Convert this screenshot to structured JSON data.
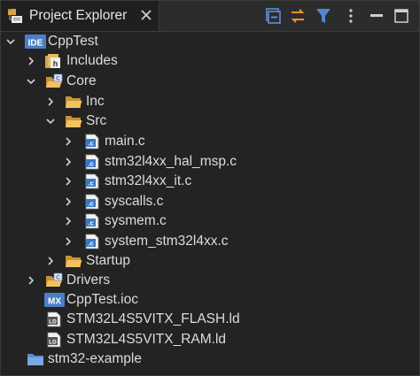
{
  "view": {
    "title": "Project Explorer"
  },
  "tree": {
    "project": "CppTest",
    "includes": "Includes",
    "core": "Core",
    "inc": "Inc",
    "src": "Src",
    "files": [
      "main.c",
      "stm32l4xx_hal_msp.c",
      "stm32l4xx_it.c",
      "syscalls.c",
      "sysmem.c",
      "system_stm32l4xx.c"
    ],
    "startup": "Startup",
    "drivers": "Drivers",
    "ioc": "CppTest.ioc",
    "flash_ld": "STM32L4S5VITX_FLASH.ld",
    "ram_ld": "STM32L4S5VITX_RAM.ld",
    "example": "stm32-example"
  },
  "badges": {
    "ide": "IDE",
    "mx": "MX",
    "c": ".c",
    "ld": "LD"
  },
  "colors": {
    "background": "#232323",
    "text": "#dcdcdc",
    "folder": "#e9b24c",
    "c_file_blue": "#3a79c9",
    "accent_orange": "#e8932f"
  }
}
